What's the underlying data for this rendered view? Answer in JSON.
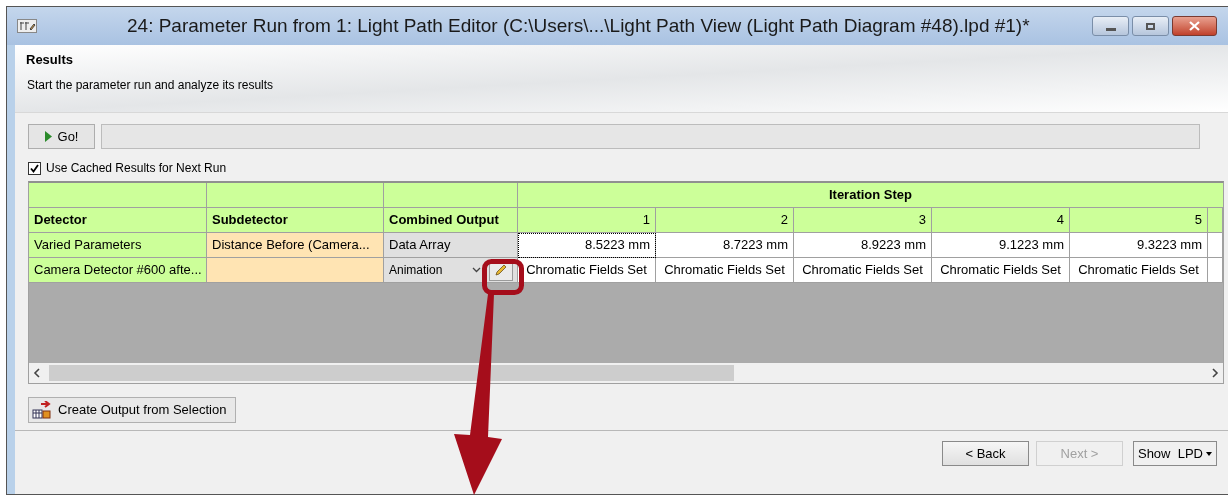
{
  "window": {
    "title": "24: Parameter Run from 1: Light Path Editor (C:\\Users\\...\\Light Path View (Light Path Diagram #48).lpd #1)*"
  },
  "header": {
    "title": "Results",
    "subtitle": "Start the parameter run and analyze its results"
  },
  "go_button": {
    "label": "Go!"
  },
  "cache_checkbox": {
    "label": "Use Cached Results for Next Run",
    "checked": true
  },
  "table": {
    "group_header": "Iteration Step",
    "columns": [
      "Detector",
      "Subdetector",
      "Combined Output"
    ],
    "steps": [
      "1",
      "2",
      "3",
      "4",
      "5"
    ],
    "rows": [
      {
        "detector": "Varied Parameters",
        "subdetector": "Distance Before (Camera...",
        "output": {
          "kind": "text",
          "value": "Data Array"
        },
        "values": [
          {
            "text": "8.5223 mm",
            "focused": true
          },
          {
            "text": "8.7223 mm",
            "focused": false
          },
          {
            "text": "8.9223 mm",
            "focused": false
          },
          {
            "text": "9.1223 mm",
            "focused": false
          },
          {
            "text": "9.3223 mm",
            "focused": false
          }
        ]
      },
      {
        "detector": "Camera Detector #600 afte...",
        "subdetector": "",
        "output": {
          "kind": "dropdown",
          "value": "Animation"
        },
        "values": [
          {
            "text": "Chromatic Fields Set",
            "focused": false
          },
          {
            "text": "Chromatic Fields Set",
            "focused": false
          },
          {
            "text": "Chromatic Fields Set",
            "focused": false
          },
          {
            "text": "Chromatic Fields Set",
            "focused": false
          },
          {
            "text": "Chromatic Fields Set",
            "focused": false
          }
        ]
      }
    ]
  },
  "create_button": {
    "label": "Create Output from Selection"
  },
  "footer": {
    "back": {
      "label": "< Back",
      "disabled": false
    },
    "next": {
      "label": "Next >",
      "disabled": true
    },
    "show": {
      "label": "Show  LPD"
    }
  }
}
